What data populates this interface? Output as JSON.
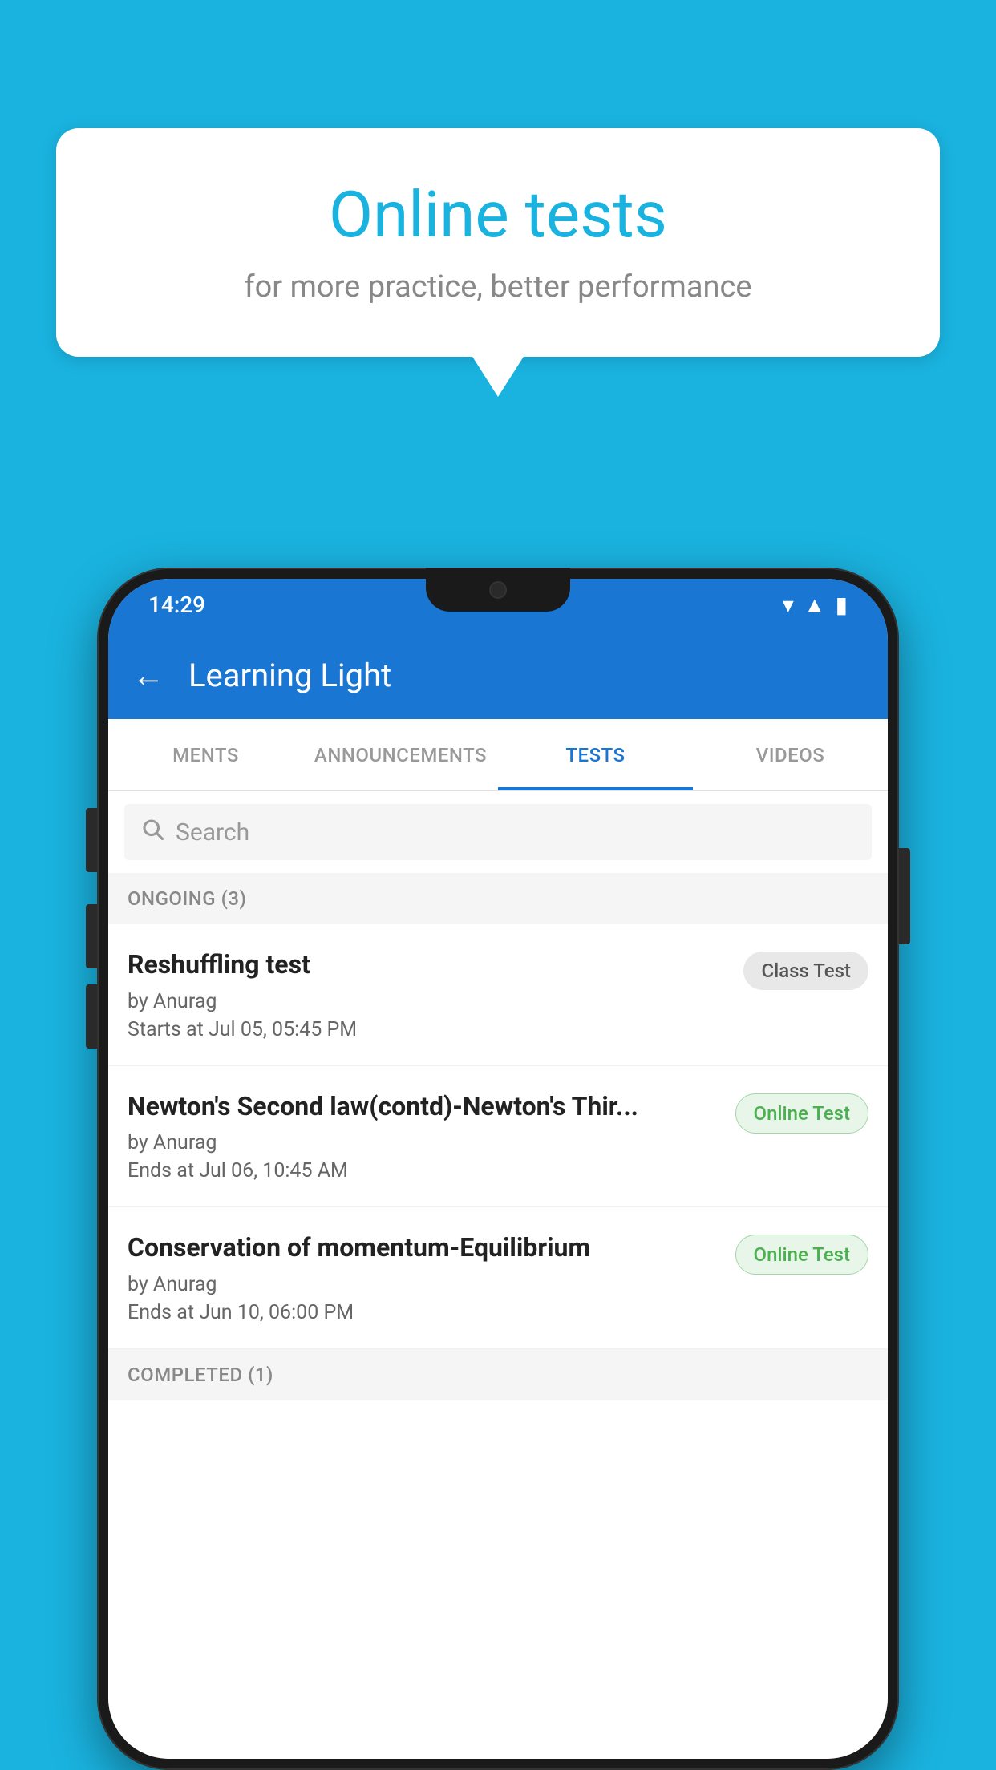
{
  "background": {
    "color": "#1ab3e0"
  },
  "speech_bubble": {
    "title": "Online tests",
    "subtitle": "for more practice, better performance"
  },
  "phone": {
    "status_bar": {
      "time": "14:29",
      "icons": [
        "wifi",
        "signal",
        "battery"
      ]
    },
    "app_bar": {
      "back_label": "←",
      "title": "Learning Light"
    },
    "tabs": [
      {
        "label": "MENTS",
        "active": false
      },
      {
        "label": "ANNOUNCEMENTS",
        "active": false
      },
      {
        "label": "TESTS",
        "active": true
      },
      {
        "label": "VIDEOS",
        "active": false
      }
    ],
    "search": {
      "placeholder": "Search"
    },
    "ongoing_section": {
      "header": "ONGOING (3)",
      "items": [
        {
          "title": "Reshuffling test",
          "author": "by Anurag",
          "date": "Starts at  Jul 05, 05:45 PM",
          "badge": "Class Test",
          "badge_type": "class"
        },
        {
          "title": "Newton's Second law(contd)-Newton's Thir...",
          "author": "by Anurag",
          "date": "Ends at  Jul 06, 10:45 AM",
          "badge": "Online Test",
          "badge_type": "online"
        },
        {
          "title": "Conservation of momentum-Equilibrium",
          "author": "by Anurag",
          "date": "Ends at  Jun 10, 06:00 PM",
          "badge": "Online Test",
          "badge_type": "online"
        }
      ]
    },
    "completed_section": {
      "header": "COMPLETED (1)"
    }
  }
}
